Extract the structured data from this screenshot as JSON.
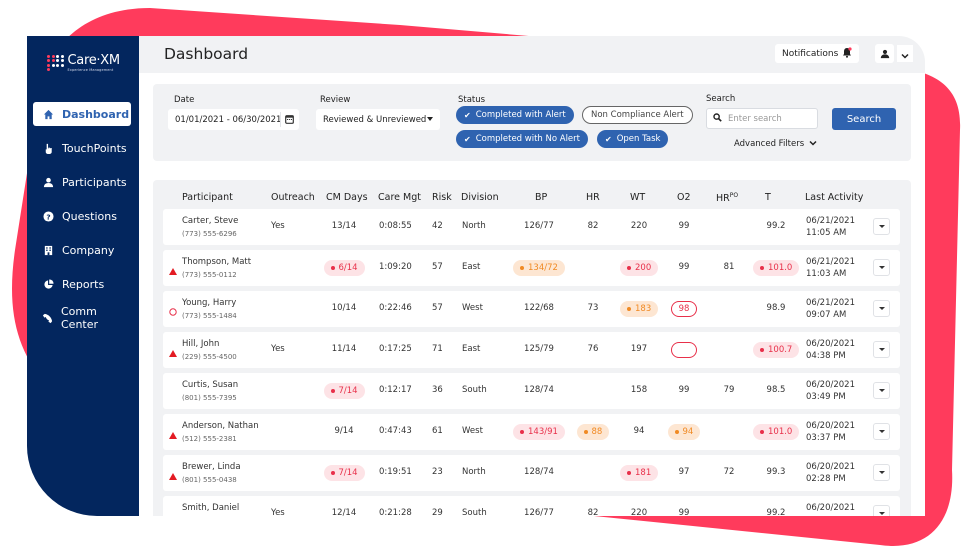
{
  "brand": {
    "logo_name": "Care·XM",
    "logo_tagline": "Experience Management",
    "accent_color": "#ff3b5c",
    "sidebar_color": "#03265e",
    "primary_color": "#2f63b0"
  },
  "sidebar": {
    "items": [
      {
        "label": "Dashboard",
        "icon": "home-icon",
        "active": true
      },
      {
        "label": "TouchPoints",
        "icon": "hand-pointer-icon",
        "active": false
      },
      {
        "label": "Participants",
        "icon": "user-icon",
        "active": false
      },
      {
        "label": "Questions",
        "icon": "question-circle-icon",
        "active": false
      },
      {
        "label": "Company",
        "icon": "building-icon",
        "active": false
      },
      {
        "label": "Reports",
        "icon": "pie-chart-icon",
        "active": false
      },
      {
        "label": "Comm Center",
        "icon": "phone-icon",
        "active": false
      }
    ]
  },
  "header": {
    "title": "Dashboard",
    "notifications_label": "Notifications"
  },
  "filters": {
    "date_label": "Date",
    "date_value": "01/01/2021 - 06/30/2021",
    "review_label": "Review",
    "review_value": "Reviewed & Unreviewed",
    "status_label": "Status",
    "status_chips": [
      {
        "label": "Completed with Alert",
        "selected": true
      },
      {
        "label": "Non Compliance Alert",
        "selected": false
      },
      {
        "label": "Completed with No Alert",
        "selected": true
      },
      {
        "label": "Open Task",
        "selected": true
      }
    ],
    "search_label": "Search",
    "search_placeholder": "Enter search",
    "search_button": "Search",
    "advanced_filters": "Advanced Filters"
  },
  "table": {
    "columns": [
      "Participant",
      "Outreach",
      "CM Days",
      "Care Mgt",
      "Risk",
      "Division",
      "BP",
      "HR",
      "WT",
      "O2",
      "HR",
      "PO",
      "T",
      "Last Activity"
    ],
    "rows": [
      {
        "alert": "none",
        "name": "Carter, Steve",
        "phone": "(773) 555-6296",
        "outreach": "Yes",
        "cm_days": "13/14",
        "care_mgt": "0:08:55",
        "risk": "42",
        "division": "North",
        "bp": "126/77",
        "hr": "82",
        "wt": "220",
        "o2": "99",
        "hrpo": "",
        "t": "99.2",
        "date": "06/21/2021",
        "time": "11:05 AM"
      },
      {
        "alert": "triangle",
        "name": "Thompson, Matt",
        "phone": "(773) 555-0112",
        "outreach": "",
        "cm_days": "6/14",
        "care_mgt": "1:09:20",
        "risk": "57",
        "division": "East",
        "bp": "134/72",
        "hr": "",
        "wt": "200",
        "o2": "99",
        "hrpo": "81",
        "t": "101.0",
        "date": "06/21/2021",
        "time": "11:03 AM"
      },
      {
        "alert": "circle",
        "name": "Young, Harry",
        "phone": "(773) 555-1484",
        "outreach": "",
        "cm_days": "10/14",
        "care_mgt": "0:22:46",
        "risk": "57",
        "division": "West",
        "bp": "122/68",
        "hr": "73",
        "wt": "183",
        "o2": "98",
        "hrpo": "",
        "t": "98.9",
        "date": "06/21/2021",
        "time": "09:07 AM"
      },
      {
        "alert": "triangle",
        "name": "Hill, John",
        "phone": "(229) 555-4500",
        "outreach": "Yes",
        "cm_days": "11/14",
        "care_mgt": "0:17:25",
        "risk": "71",
        "division": "East",
        "bp": "125/79",
        "hr": "76",
        "wt": "197",
        "o2": "",
        "hrpo": "",
        "t": "100.7",
        "date": "06/20/2021",
        "time": "04:38 PM"
      },
      {
        "alert": "none",
        "name": "Curtis, Susan",
        "phone": "(801) 555-7395",
        "outreach": "",
        "cm_days": "7/14",
        "care_mgt": "0:12:17",
        "risk": "36",
        "division": "South",
        "bp": "128/74",
        "hr": "",
        "wt": "158",
        "o2": "99",
        "hrpo": "79",
        "t": "98.5",
        "date": "06/20/2021",
        "time": "03:49 PM"
      },
      {
        "alert": "triangle",
        "name": "Anderson, Nathan",
        "phone": "(512) 555-2381",
        "outreach": "",
        "cm_days": "9/14",
        "care_mgt": "0:47:43",
        "risk": "61",
        "division": "West",
        "bp": "143/91",
        "hr": "88",
        "wt": "94",
        "o2": "94",
        "hrpo": "",
        "t": "101.0",
        "date": "06/20/2021",
        "time": "03:37 PM"
      },
      {
        "alert": "triangle",
        "name": "Brewer, Linda",
        "phone": "(801) 555-0438",
        "outreach": "",
        "cm_days": "7/14",
        "care_mgt": "0:19:51",
        "risk": "23",
        "division": "North",
        "bp": "128/74",
        "hr": "",
        "wt": "181",
        "o2": "97",
        "hrpo": "72",
        "t": "99.3",
        "date": "06/20/2021",
        "time": "02:28 PM"
      },
      {
        "alert": "none",
        "name": "Smith, Daniel",
        "phone": "",
        "outreach": "Yes",
        "cm_days": "12/14",
        "care_mgt": "0:21:28",
        "risk": "29",
        "division": "South",
        "bp": "126/77",
        "hr": "82",
        "wt": "220",
        "o2": "99",
        "hrpo": "",
        "t": "99.2",
        "date": "06/20/2021",
        "time": ""
      }
    ]
  }
}
